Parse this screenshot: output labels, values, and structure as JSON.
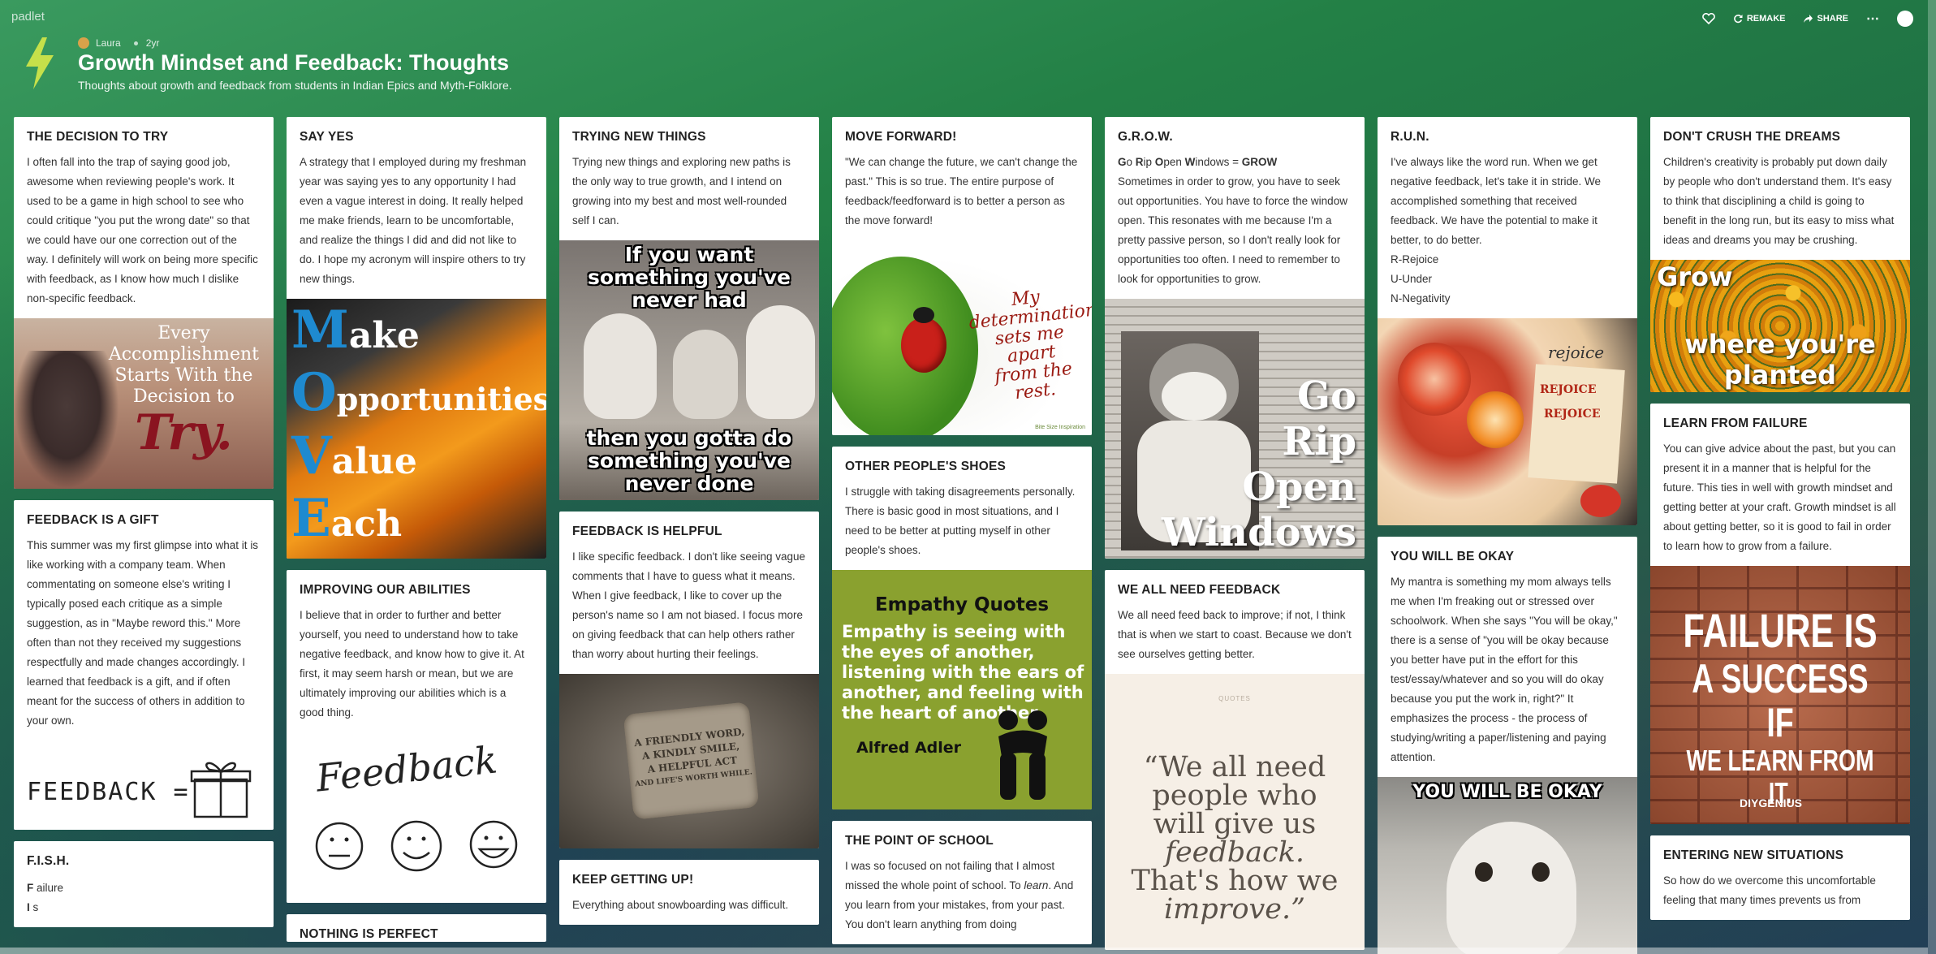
{
  "app": {
    "brand": "padlet"
  },
  "header": {
    "author": "Laura",
    "age": "2yr",
    "title": "Growth Mindset and Feedback: Thoughts",
    "subtitle": "Thoughts about growth and feedback from students in Indian Epics and Myth-Folklore.",
    "actions": {
      "remake": "REMAKE",
      "share": "SHARE",
      "more": "⋯"
    }
  },
  "colors": {
    "accent": "#2e8a57",
    "bolt": "#c6e04a"
  },
  "icons": [
    "heart-icon",
    "remake-icon",
    "share-icon",
    "more-icon",
    "lightning-bolt-icon"
  ],
  "cards": {
    "c1": {
      "title": "THE DECISION TO TRY",
      "body": "I often fall into the trap of saying good job, awesome when reviewing people's work. It used to be a game in high school to see who could critique \"you put the wrong date\" so that we could have our one correction out of the way. I definitely will work on being more specific with feedback, as I know how much I dislike non-specific feedback.",
      "img_text": [
        "Every",
        "Accomplishment",
        "Starts With the",
        "Decision to",
        "Try."
      ]
    },
    "c2": {
      "title": "FEEDBACK IS A GIFT",
      "body": "This summer was my first glimpse into what it is like working with a company team. When commentating on someone else's writing I typically posed each critique as a simple suggestion, as in \"Maybe reword this.\" More often than not they received my suggestions respectfully and made changes accordingly. I learned that feedback is a gift, and if often meant for the success of others in addition to your own.",
      "img_text": "FEEDBACK ="
    },
    "c3": {
      "title": "F.I.S.H.",
      "lines": [
        {
          "b": "F",
          "t": " ailure"
        },
        {
          "b": "I",
          "t": " s"
        }
      ]
    },
    "c4": {
      "title": "SAY YES",
      "body": "A strategy that I employed during my freshman year was saying yes to any opportunity I had even a vague interest in doing. It really helped me make friends, learn to be uncomfortable, and realize the things I did and did not like to do. I hope my acronym will inspire others to try new things.",
      "img_text": [
        {
          "l": "M",
          "r": "ake"
        },
        {
          "l": "O",
          "r": "pportunities"
        },
        {
          "l": "V",
          "r": "alue"
        },
        {
          "l": "E",
          "r": "ach"
        }
      ]
    },
    "c5": {
      "title": "IMPROVING OUR ABILITIES",
      "body": "I believe that in order to further and better yourself, you need to understand how to take negative feedback, and know how to give it. At first, it may seem harsh or mean, but we are ultimately improving our abilities which is a good thing.",
      "img_text": "Feedback"
    },
    "c6": {
      "title": "NOTHING IS PERFECT"
    },
    "c7": {
      "title": "TRYING NEW THINGS",
      "body": "Trying new things and exploring new paths is the only way to true growth, and I intend on growing into my best and most well-rounded self I can.",
      "img_top": "If you want something you've never had",
      "img_bottom": "then you gotta do something you've never done"
    },
    "c8": {
      "title": "FEEDBACK IS HELPFUL",
      "body": "I like specific feedback. I don't like seeing vague comments that I have to guess what it means. When I give feedback, I like to cover up the person's name so I am not biased. I focus more on giving feedback that can help others rather than worry about hurting their feelings.",
      "img_text": [
        "A FRIENDLY WORD,",
        "A KINDLY SMILE,",
        "A HELPFUL ACT",
        "AND LIFE'S WORTH WHILE."
      ]
    },
    "c9": {
      "title": "KEEP GETTING UP!",
      "body": "Everything about snowboarding was difficult."
    },
    "c10": {
      "title": "MOVE FORWARD!",
      "body": "\"We can change the future, we can't change the past.\" This is so true. The entire purpose of feedback/feedforward is to better a person as the move forward!",
      "img_text": [
        "My determination",
        "sets me apart",
        "from the rest."
      ],
      "img_credit": "Bite Size Inspiration"
    },
    "c11": {
      "title": "OTHER PEOPLE'S SHOES",
      "body": "I struggle with taking disagreements personally. There is basic good in most situations, and I need to be better at putting myself in other people's shoes.",
      "img_title": "Empathy Quotes",
      "img_quote": "Empathy is seeing with the eyes of another, listening with the ears of another, and feeling with the heart of another",
      "img_author": "Alfred Adler"
    },
    "c12": {
      "title": "THE POINT OF SCHOOL",
      "body_parts": [
        "I was so focused on not failing that I almost missed the whole point of school. To ",
        "learn",
        ". And you learn from your mistakes, from your past. You don't learn anything from doing"
      ]
    },
    "c13": {
      "title": "G.R.O.W.",
      "acronym": [
        {
          "b": "G",
          "t": "o "
        },
        {
          "b": "R",
          "t": "ip "
        },
        {
          "b": "O",
          "t": "pen "
        },
        {
          "b": "W",
          "t": "indows = "
        },
        {
          "b": "GROW",
          "t": ""
        }
      ],
      "body": "Sometimes in order to grow, you have to seek out opportunities.  You have to force the window open.  This resonates with me because I'm a pretty passive person, so I don't really look for opportunities too often. I need to remember to look for opportunities to grow.",
      "img_text": [
        "Go",
        "Rip",
        "Open",
        "Windows"
      ]
    },
    "c14": {
      "title": "WE ALL NEED FEEDBACK",
      "body": "We all need feed back to improve; if not, I think that is when we start to coast. Because we don't see ourselves getting better.",
      "img_small": "QUOTES",
      "img_quote": [
        "“We all need",
        "people who",
        "will give us",
        "feedback.",
        "That's how we",
        "improve.”"
      ]
    },
    "c15": {
      "title": "R.U.N.",
      "body": "I've always like the word run. When we get negative feedback, let's take it in stride. We accomplished something that received feedback. We have the potential to make it better, to do better.",
      "list": [
        "R-Rejoice",
        "U-Under",
        "N-Negativity"
      ],
      "img_text": [
        "rejoice",
        "REJOICE",
        "REJOICE"
      ]
    },
    "c16": {
      "title": "YOU WILL BE OKAY",
      "body": "My mantra is something my mom always tells me when I'm freaking out or stressed over schoolwork. When she says \"You will be okay,\" there is a sense of \"you will be okay because you better have put in the effort for this test/essay/whatever and so you will do okay because you put the work in, right?\" It emphasizes the process - the process of studying/writing a paper/listening and paying attention.",
      "img_text": "YOU WILL BE OKAY"
    },
    "c17": {
      "title": "DON'T CRUSH THE DREAMS",
      "body": "Children's creativity is probably put down daily by people who don't understand them. It's easy to think that disciplining a child is going to benefit in the long run, but its easy to miss what ideas and dreams you may be crushing.",
      "img_top": "Grow",
      "img_bottom": "where you're planted"
    },
    "c18": {
      "title": "LEARN FROM FAILURE",
      "body": "You can give advice about the past, but you can present it in a manner that is helpful for the future. This ties in well with growth mindset and getting better at your craft. Growth mindset is all about getting better, so it is good to fail in order to learn how to grow from a failure.",
      "img_text": [
        "FAILURE IS",
        "A SUCCESS IF",
        "WE LEARN FROM IT."
      ],
      "img_credit": "DIYGENIUS"
    },
    "c19": {
      "title": "ENTERING NEW SITUATIONS",
      "body": "So how do we overcome this uncomfortable feeling that many times prevents us from"
    }
  }
}
